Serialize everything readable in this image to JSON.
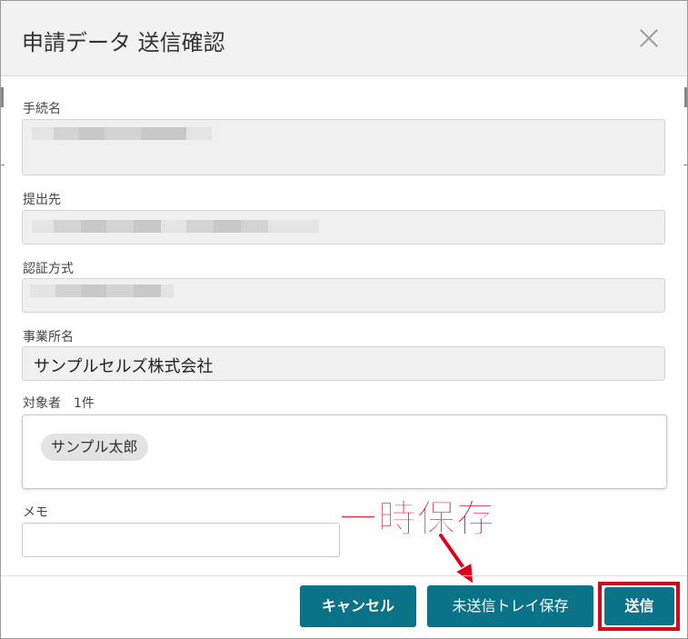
{
  "dialog": {
    "title": "申請データ 送信確認",
    "close_icon": "close-icon"
  },
  "fields": {
    "procedure_name_label": "手続名",
    "submit_to_label": "提出先",
    "auth_method_label": "認証方式",
    "office_name_label": "事業所名",
    "office_name_value": "サンプルセルズ株式会社",
    "targets_label": "対象者　1件",
    "targets": [
      "サンプル太郎"
    ],
    "memo_label": "メモ",
    "memo_value": ""
  },
  "footer": {
    "cancel_label": "キャンセル",
    "save_tray_label": "未送信トレイ保存",
    "send_label": "送信"
  },
  "annotation": {
    "text": "一時保存",
    "color": "#e0001b",
    "highlight_color": "#d8001c"
  },
  "colors": {
    "button_bg": "#0a7387",
    "header_bg": "#f2f2f2",
    "field_bg": "#f1f0f0"
  }
}
